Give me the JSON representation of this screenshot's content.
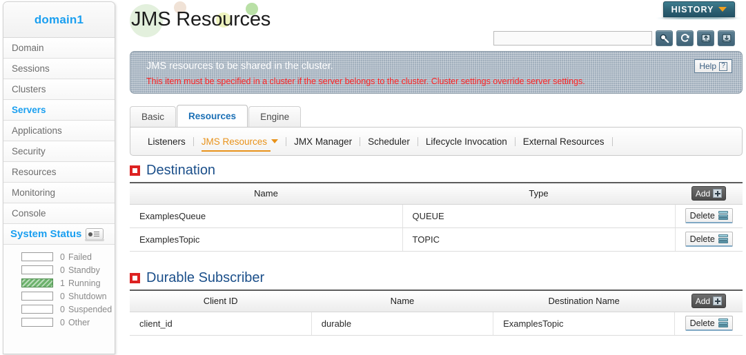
{
  "sidebar": {
    "domain_label": "domain1",
    "items": [
      {
        "label": "Domain",
        "active": false
      },
      {
        "label": "Sessions",
        "active": false
      },
      {
        "label": "Clusters",
        "active": false
      },
      {
        "label": "Servers",
        "active": true
      },
      {
        "label": "Applications",
        "active": false
      },
      {
        "label": "Security",
        "active": false
      },
      {
        "label": "Resources",
        "active": false
      },
      {
        "label": "Monitoring",
        "active": false
      },
      {
        "label": "Console",
        "active": false
      }
    ],
    "system_status": {
      "title": "System Status",
      "icon": "monitor-icon",
      "rows": [
        {
          "count": "0",
          "label": "Failed",
          "filled": false
        },
        {
          "count": "0",
          "label": "Standby",
          "filled": false
        },
        {
          "count": "1",
          "label": "Running",
          "filled": true
        },
        {
          "count": "0",
          "label": "Shutdown",
          "filled": false
        },
        {
          "count": "0",
          "label": "Suspended",
          "filled": false
        },
        {
          "count": "0",
          "label": "Other",
          "filled": false
        }
      ]
    }
  },
  "header": {
    "title": "JMS Resources",
    "history_label": "HISTORY",
    "history_caret": "chevron-down-icon"
  },
  "toolbar": {
    "search_value": "",
    "search_placeholder": "",
    "buttons": [
      {
        "name": "search-icon",
        "label": "Search"
      },
      {
        "name": "refresh-icon",
        "label": "Refresh"
      },
      {
        "name": "xml-upload-icon",
        "label": "XML Upload"
      },
      {
        "name": "xml-download-icon",
        "label": "XML Download"
      }
    ]
  },
  "banner": {
    "line1": "JMS resources to be shared in the cluster.",
    "line2": "This item must be specified in a cluster if the server belongs to the cluster. Cluster settings override server settings.",
    "help_label": "Help",
    "help_icon": "question-mark-icon",
    "accent_color": "#ff2020",
    "background_color": "#9fadbb"
  },
  "tabs": [
    {
      "label": "Basic",
      "active": false
    },
    {
      "label": "Resources",
      "active": true
    },
    {
      "label": "Engine",
      "active": false
    }
  ],
  "subnav": [
    {
      "label": "Listeners",
      "active": false,
      "caret": false
    },
    {
      "label": "JMS Resources",
      "active": true,
      "caret": true
    },
    {
      "label": "JMX Manager",
      "active": false,
      "caret": false
    },
    {
      "label": "Scheduler",
      "active": false,
      "caret": false
    },
    {
      "label": "Lifecycle Invocation",
      "active": false,
      "caret": false
    },
    {
      "label": "External Resources",
      "active": false,
      "caret": false
    }
  ],
  "sections": [
    {
      "title": "Destination",
      "add_label": "Add",
      "columns": [
        "Name",
        "Type"
      ],
      "rows": [
        {
          "cells": [
            "ExamplesQueue",
            "QUEUE"
          ],
          "action": "Delete"
        },
        {
          "cells": [
            "ExamplesTopic",
            "TOPIC"
          ],
          "action": "Delete"
        }
      ]
    },
    {
      "title": "Durable Subscriber",
      "add_label": "Add",
      "columns": [
        "Client ID",
        "Name",
        "Destination Name"
      ],
      "rows": [
        {
          "cells": [
            "client_id",
            "durable",
            "ExamplesTopic"
          ],
          "action": "Delete"
        }
      ]
    }
  ],
  "colors": {
    "brand_blue": "#1a9ff0",
    "section_blue": "#1b4f8a",
    "accent_orange": "#e8921a",
    "history_teal": "#2f6375",
    "status_green": "#6cb26c",
    "alert_red": "#ff2020"
  }
}
